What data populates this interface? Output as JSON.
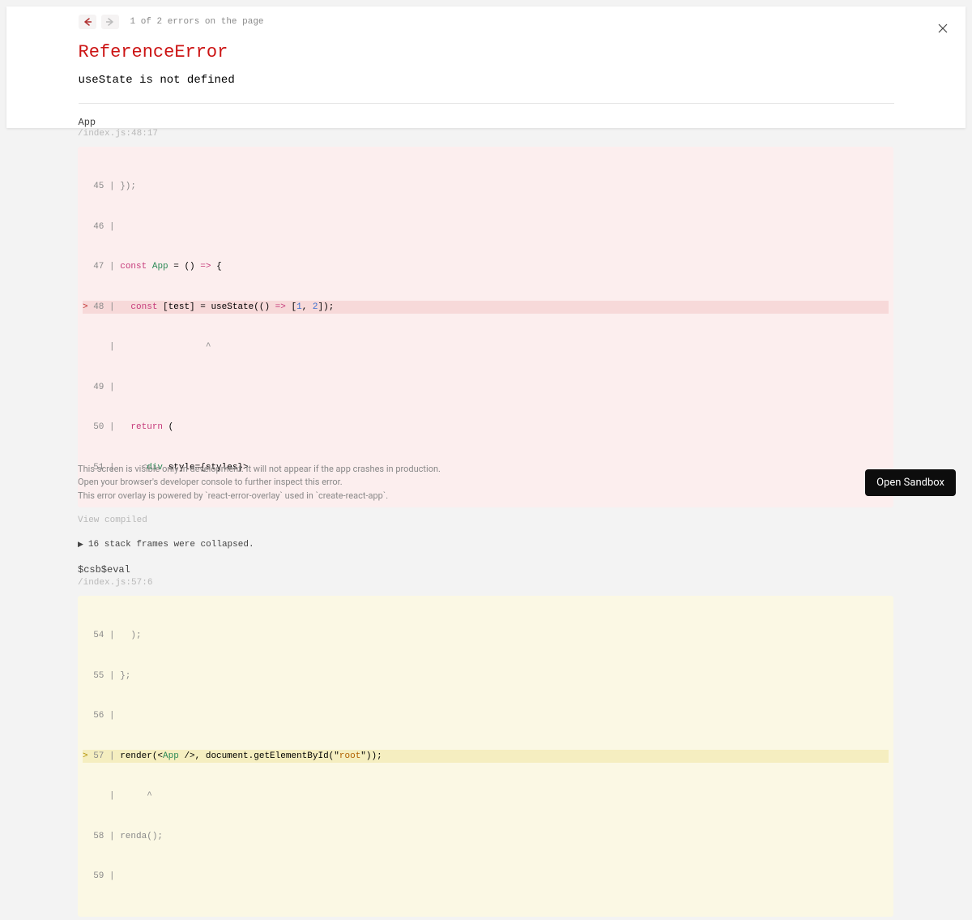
{
  "nav": {
    "count_text": "1 of 2 errors on the page"
  },
  "error": {
    "type": "ReferenceError",
    "message": "useState is not defined"
  },
  "frame1": {
    "fn": "App",
    "loc": "/index.js:48:17",
    "lines": {
      "l45": "  45 | });",
      "l46": "  46 | ",
      "l47_pre": "  47 | ",
      "l47_kw1": "const",
      "l47_sp1": " ",
      "l47_id": "App",
      "l47_op1": " = () ",
      "l47_arrow": "=>",
      "l47_rest": " {",
      "l48_mark": "> ",
      "l48_ln": "48 | ",
      "l48_sp": "  ",
      "l48_kw": "const",
      "l48_mid": " [test] = useState(() ",
      "l48_arrow": "=>",
      "l48_arr": " [",
      "l48_n1": "1",
      "l48_c": ", ",
      "l48_n2": "2",
      "l48_end": "]);",
      "lcaret": "     |                 ^",
      "l49": "  49 | ",
      "l50_pre": "  50 |   ",
      "l50_kw": "return",
      "l50_rest": " (",
      "l51_pre": "  51 |     <",
      "l51_tag": "div",
      "l51_mid": " style={styles}>"
    },
    "view_compiled": "View compiled"
  },
  "collapse_text": "16 stack frames were collapsed.",
  "frame2": {
    "fn": "$csb$eval",
    "loc": "/index.js:57:6",
    "lines": {
      "l54": "  54 |   );",
      "l55": "  55 | };",
      "l56": "  56 | ",
      "l57_mark": "> ",
      "l57_ln": "57 | ",
      "l57_a": "render(<",
      "l57_tag": "App",
      "l57_b": " />, document.getElementById(\"",
      "l57_str": "root",
      "l57_c": "\"));",
      "lcaret": "     |      ^",
      "l58": "  58 | renda();",
      "l59": "  59 | "
    }
  },
  "footer": {
    "l1": "This screen is visible only in development. It will not appear if the app crashes in production.",
    "l2": "Open your browser's developer console to further inspect this error.",
    "l3": "This error overlay is powered by `react-error-overlay` used in `create-react-app`."
  },
  "sandbox_label": "Open Sandbox"
}
